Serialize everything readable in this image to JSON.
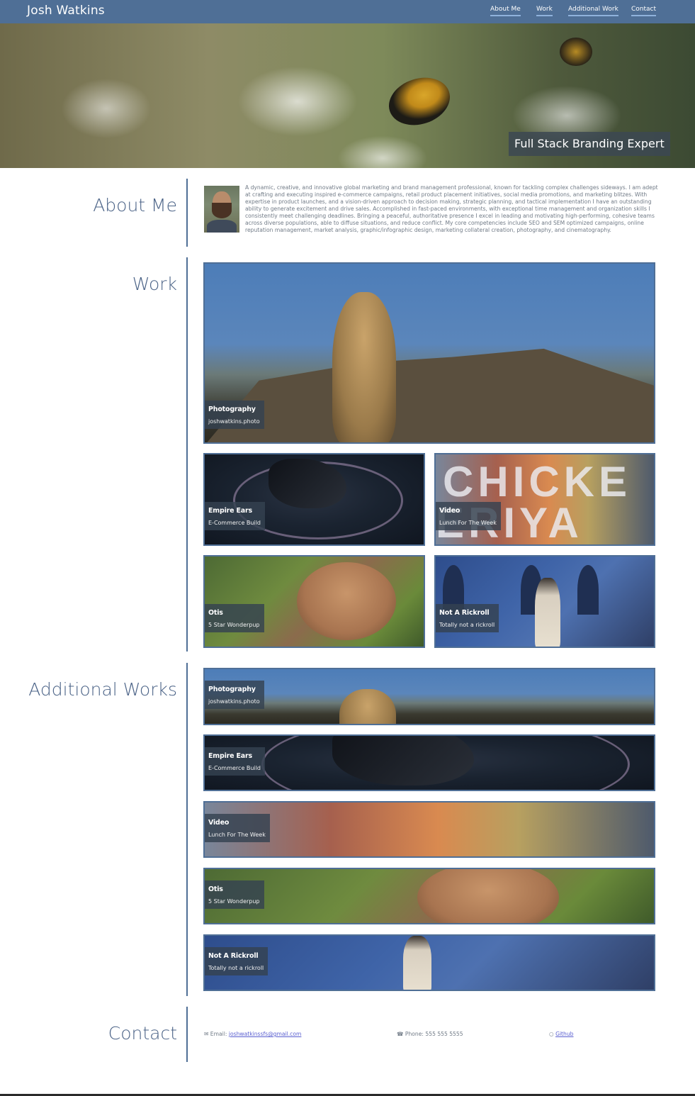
{
  "nav": {
    "brand": "Josh Watkins",
    "links": [
      "About Me",
      "Work",
      "Additional Work",
      "Contact"
    ]
  },
  "hero": {
    "tagline": "Full Stack Branding Expert"
  },
  "about": {
    "title": "About Me",
    "text": "A dynamic, creative, and innovative global marketing and brand management professional, known for tackling complex challenges sideways. I am adept at crafting and executing inspired e-commerce campaigns, retail product placement initiatives, social media promotions, and marketing blitzes. With expertise in product launches, and a vision-driven approach to decision making, strategic planning, and tactical implementation I have an outstanding ability to generate excitement and drive sales. Accomplished in fast-paced environments, with exceptional time management and organization skills I consistently meet challenging deadlines. Bringing a peaceful, authoritative presence I excel in leading and motivating high-performing, cohesive teams across diverse populations, able to diffuse situations, and reduce conflict. My core competencies include SEO and SEM optimized campaigns, online reputation management, market analysis, graphic/infographic design, marketing collateral creation, photography, and cinematography."
  },
  "work": {
    "title": "Work",
    "cards": [
      {
        "title": "Photography",
        "subtitle": "joshwatkins.photo"
      },
      {
        "title": "Empire Ears",
        "subtitle": "E-Commerce Build"
      },
      {
        "title": "Video",
        "subtitle": "Lunch For The Week",
        "overlay_top": "CHICKE",
        "overlay_bottom": "ERIYA"
      },
      {
        "title": "Otis",
        "subtitle": "5 Star Wonderpup"
      },
      {
        "title": "Not A Rickroll",
        "subtitle": "Totally not a rickroll"
      }
    ]
  },
  "additional": {
    "title": "Additional Works",
    "cards": [
      {
        "title": "Photography",
        "subtitle": "joshwatkins.photo"
      },
      {
        "title": "Empire Ears",
        "subtitle": "E-Commerce Build"
      },
      {
        "title": "Video",
        "subtitle": "Lunch For The Week"
      },
      {
        "title": "Otis",
        "subtitle": "5 Star Wonderpup"
      },
      {
        "title": "Not A Rickroll",
        "subtitle": "Totally not a rickroll"
      }
    ]
  },
  "contact": {
    "title": "Contact",
    "email_label": "Email:",
    "email": "joshwatkinssfs@gmail.com",
    "phone_label": "Phone:",
    "phone": "555 555 5555",
    "github": "Github"
  },
  "icons": {
    "email": "envelope-icon",
    "phone": "phone-icon",
    "github": "github-icon"
  },
  "colors": {
    "nav": "#4f6f96",
    "accent": "#4f6f96",
    "heading": "#4b6387",
    "label_bg": "#344250"
  }
}
